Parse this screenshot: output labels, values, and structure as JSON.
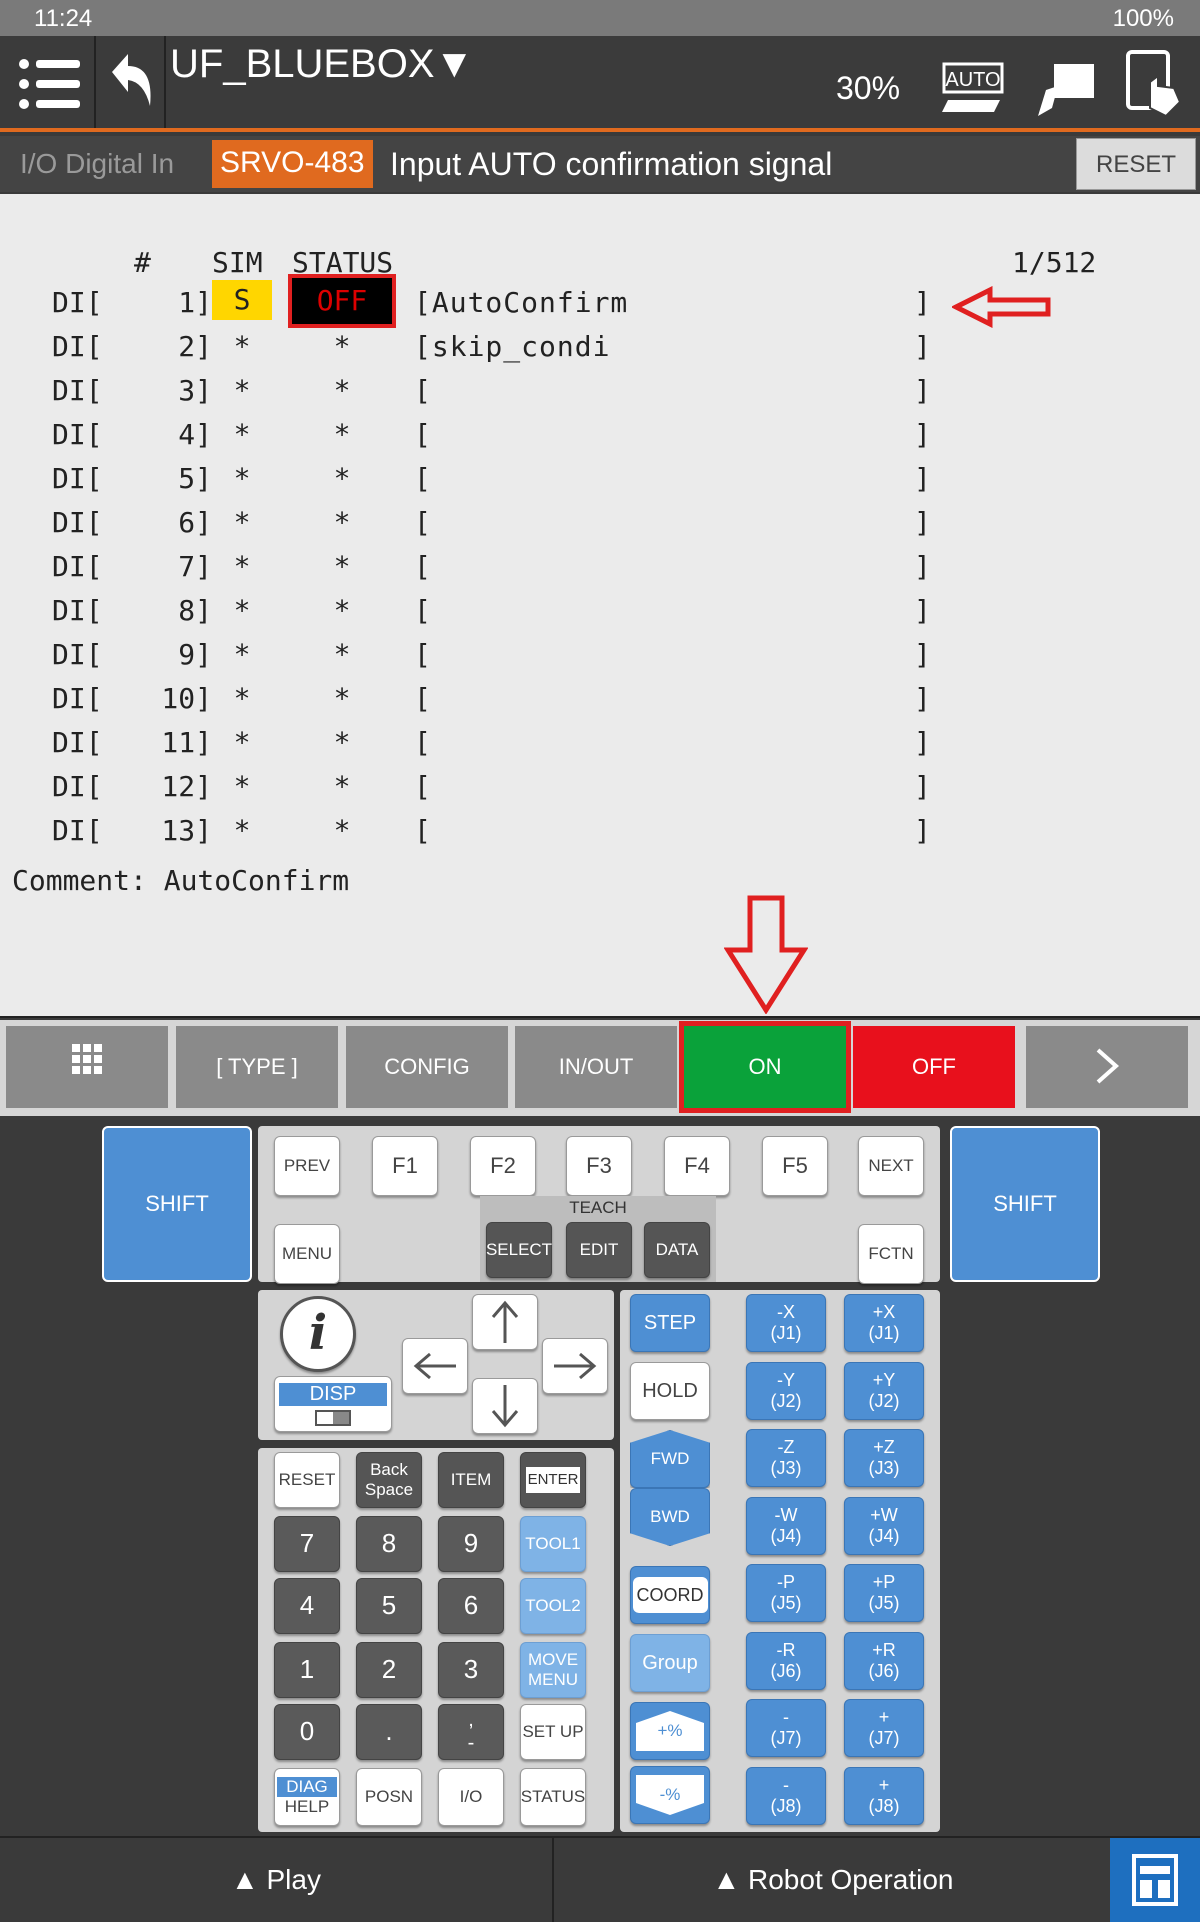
{
  "status_bar": {
    "time": "11:24",
    "battery": "100%"
  },
  "top_bar": {
    "title": "UF_BLUEBOX",
    "dropdown_glyph": "▼",
    "override": "30%",
    "auto_label": "AUTO"
  },
  "alarm_bar": {
    "screen_name": "I/O Digital In",
    "alarm_code": "SRVO-483",
    "alarm_message": "Input AUTO confirmation signal",
    "reset_label": "RESET"
  },
  "io_screen": {
    "headers": {
      "num": "#",
      "sim": "SIM",
      "status": "STATUS",
      "page": "1/512"
    },
    "rows": [
      {
        "type": "DI[",
        "num": "1]",
        "sim": "S",
        "status": "OFF",
        "comment": "[AutoConfirm",
        "end": "]"
      },
      {
        "type": "DI[",
        "num": "2]",
        "sim": "*",
        "status": "*",
        "comment": "[skip_condi",
        "end": "]"
      },
      {
        "type": "DI[",
        "num": "3]",
        "sim": "*",
        "status": "*",
        "comment": "[",
        "end": "]"
      },
      {
        "type": "DI[",
        "num": "4]",
        "sim": "*",
        "status": "*",
        "comment": "[",
        "end": "]"
      },
      {
        "type": "DI[",
        "num": "5]",
        "sim": "*",
        "status": "*",
        "comment": "[",
        "end": "]"
      },
      {
        "type": "DI[",
        "num": "6]",
        "sim": "*",
        "status": "*",
        "comment": "[",
        "end": "]"
      },
      {
        "type": "DI[",
        "num": "7]",
        "sim": "*",
        "status": "*",
        "comment": "[",
        "end": "]"
      },
      {
        "type": "DI[",
        "num": "8]",
        "sim": "*",
        "status": "*",
        "comment": "[",
        "end": "]"
      },
      {
        "type": "DI[",
        "num": "9]",
        "sim": "*",
        "status": "*",
        "comment": "[",
        "end": "]"
      },
      {
        "type": "DI[",
        "num": "10]",
        "sim": "*",
        "status": "*",
        "comment": "[",
        "end": "]"
      },
      {
        "type": "DI[",
        "num": "11]",
        "sim": "*",
        "status": "*",
        "comment": "[",
        "end": "]"
      },
      {
        "type": "DI[",
        "num": "12]",
        "sim": "*",
        "status": "*",
        "comment": "[",
        "end": "]"
      },
      {
        "type": "DI[",
        "num": "13]",
        "sim": "*",
        "status": "*",
        "comment": "[",
        "end": "]"
      }
    ],
    "comment_line": "Comment: AutoConfirm"
  },
  "function_keys": {
    "type": "[ TYPE ]",
    "config": "CONFIG",
    "in_out": "IN/OUT",
    "on": "ON",
    "off": "OFF"
  },
  "pendant": {
    "shift": "SHIFT",
    "prev": "PREV",
    "f1": "F1",
    "f2": "F2",
    "f3": "F3",
    "f4": "F4",
    "f5": "F5",
    "next": "NEXT",
    "menu": "MENU",
    "teach": "TEACH",
    "select": "SELECT",
    "edit": "EDIT",
    "data": "DATA",
    "fctn": "FCTN",
    "disp": "DISP",
    "reset": "RESET",
    "backspace": "Back Space",
    "item": "ITEM",
    "enter": "ENTER",
    "n7": "7",
    "n8": "8",
    "n9": "9",
    "tool1": "TOOL1",
    "n4": "4",
    "n5": "5",
    "n6": "6",
    "tool2": "TOOL2",
    "n1": "1",
    "n2": "2",
    "n3": "3",
    "move_menu": "MOVE MENU",
    "n0": "0",
    "dot": ".",
    "comma": ",\n-",
    "setup": "SET UP",
    "diag": "DIAG",
    "help": "HELP",
    "posn": "POSN",
    "io": "I/O",
    "status": "STATUS",
    "step": "STEP",
    "hold": "HOLD",
    "fwd": "FWD",
    "bwd": "BWD",
    "coord": "COORD",
    "group": "Group",
    "plus_pct": "+%",
    "minus_pct": "-%",
    "jog": [
      {
        "m": "-X\n(J1)",
        "p": "+X\n(J1)"
      },
      {
        "m": "-Y\n(J2)",
        "p": "+Y\n(J2)"
      },
      {
        "m": "-Z\n(J3)",
        "p": "+Z\n(J3)"
      },
      {
        "m": "-W\n(J4)",
        "p": "+W\n(J4)"
      },
      {
        "m": "-P\n(J5)",
        "p": "+P\n(J5)"
      },
      {
        "m": "-R\n(J6)",
        "p": "+R\n(J6)"
      },
      {
        "m": "-\n(J7)",
        "p": "+\n(J7)"
      },
      {
        "m": "-\n(J8)",
        "p": "+\n(J8)"
      }
    ]
  },
  "bottom_bar": {
    "play": "▲  Play",
    "robot_operation": "▲  Robot Operation"
  }
}
